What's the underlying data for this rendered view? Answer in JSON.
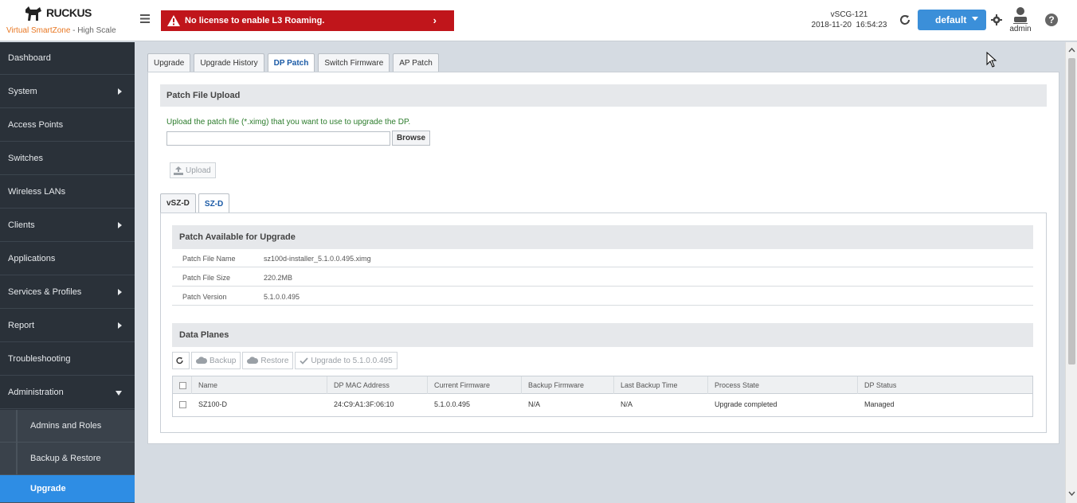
{
  "brand": {
    "logo_text": "RUCKUS",
    "subtitle_accent": "Virtual SmartZone",
    "subtitle_rest": " - High Scale",
    "accent_color": "#e87722"
  },
  "alert": {
    "text": "No license to enable L3 Roaming.",
    "color": "#c0151b"
  },
  "cluster": {
    "name": "vSCG-121",
    "datetime": "2018-11-20  16:54:23"
  },
  "domain_button": {
    "label": "default"
  },
  "user": {
    "name": "admin"
  },
  "help": {
    "glyph": "?"
  },
  "sidebar": {
    "items": [
      {
        "label": "Dashboard",
        "has_arrow": false
      },
      {
        "label": "System",
        "has_arrow": true
      },
      {
        "label": "Access Points",
        "has_arrow": false
      },
      {
        "label": "Switches",
        "has_arrow": false
      },
      {
        "label": "Wireless LANs",
        "has_arrow": false
      },
      {
        "label": "Clients",
        "has_arrow": true
      },
      {
        "label": "Applications",
        "has_arrow": false
      },
      {
        "label": "Services & Profiles",
        "has_arrow": true
      },
      {
        "label": "Report",
        "has_arrow": true
      },
      {
        "label": "Troubleshooting",
        "has_arrow": false
      },
      {
        "label": "Administration",
        "has_arrow": true,
        "expanded": true
      }
    ],
    "sub_items": [
      {
        "label": "Admins and Roles"
      },
      {
        "label": "Backup & Restore"
      },
      {
        "label": "Upgrade",
        "active": true
      }
    ]
  },
  "tabs": [
    {
      "label": "Upgrade"
    },
    {
      "label": "Upgrade History"
    },
    {
      "label": "DP Patch",
      "active": true
    },
    {
      "label": "Switch Firmware"
    },
    {
      "label": "AP Patch"
    }
  ],
  "patch_upload": {
    "title": "Patch File Upload",
    "hint": "Upload the patch file (*.ximg) that you want to use to upgrade the DP.",
    "file_value": "",
    "browse_label": "Browse",
    "upload_label": "Upload"
  },
  "subtabs": [
    {
      "label": "vSZ-D"
    },
    {
      "label": "SZ-D",
      "active": true
    }
  ],
  "patch_available": {
    "title": "Patch Available for Upgrade",
    "rows": [
      {
        "key": "Patch File Name",
        "value": "sz100d-installer_5.1.0.0.495.ximg"
      },
      {
        "key": "Patch File Size",
        "value": "220.2MB"
      },
      {
        "key": "Patch Version",
        "value": "5.1.0.0.495"
      }
    ]
  },
  "data_planes": {
    "title": "Data Planes",
    "toolbar": {
      "backup": "Backup",
      "restore": "Restore",
      "upgrade": "Upgrade to 5.1.0.0.495"
    },
    "columns": [
      "Name",
      "DP MAC Address",
      "Current Firmware",
      "Backup Firmware",
      "Last Backup Time",
      "Process State",
      "DP Status"
    ],
    "rows": [
      [
        "SZ100-D",
        "24:C9:A1:3F:06:10",
        "5.1.0.0.495",
        "N/A",
        "N/A",
        "Upgrade completed",
        "Managed"
      ]
    ]
  }
}
